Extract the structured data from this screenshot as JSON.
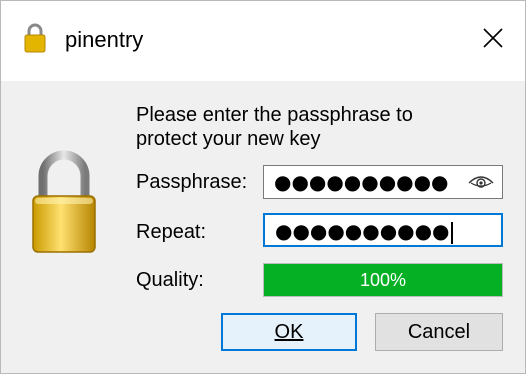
{
  "window": {
    "title": "pinentry",
    "icons": {
      "title": "padlock-icon",
      "close": "close-icon",
      "main": "padlock-icon",
      "toggle": "eye-icon"
    }
  },
  "prompt": {
    "line1": "Please enter the passphrase to",
    "line2": "protect your new key"
  },
  "form": {
    "passphrase_label": "Passphrase:",
    "passphrase_value": "●●●●●●●●●●",
    "repeat_label": "Repeat:",
    "repeat_value": "●●●●●●●●●●",
    "quality_label": "Quality:",
    "quality_text": "100%",
    "quality_fraction": 1.0
  },
  "buttons": {
    "ok_label": "OK",
    "cancel_label": "Cancel"
  },
  "colors": {
    "quality_fill": "#06b025",
    "focus": "#0078d7"
  }
}
